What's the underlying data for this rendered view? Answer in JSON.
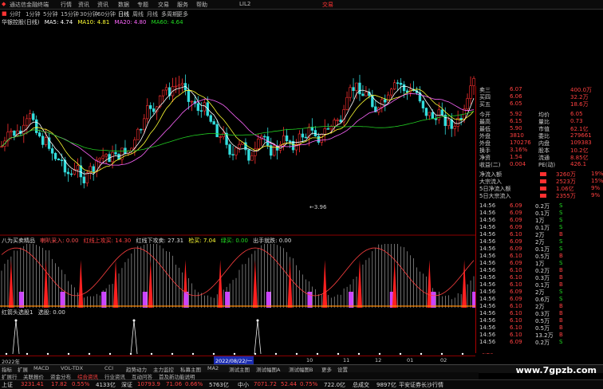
{
  "app": {
    "title": "通达信金融终端",
    "code": "LIL2",
    "trade_label": "交易"
  },
  "menu": [
    "行情",
    "资讯",
    "商城",
    "系统",
    "功能",
    "行情",
    "资讯",
    "数据",
    "专题",
    "交易",
    "服务",
    "帮助"
  ],
  "periods": [
    "分时",
    "1分钟",
    "5分钟",
    "15分钟",
    "30分钟",
    "60分钟",
    "日线",
    "周线",
    "月线",
    "多周期",
    "更多"
  ],
  "stock": {
    "name": "华银控股(日线)"
  },
  "ma": {
    "ma5": "MA5: 4.74",
    "ma10": "MA10: 4.81",
    "ma20": "MA20: 4.80",
    "ma60": "MA60: 4.64"
  },
  "price_axis": [
    "5.00",
    "4.90",
    "4.80",
    "4.70",
    "4.60",
    "4.50",
    "4.40",
    "4.30",
    "4.20",
    "4.10",
    "4.01"
  ],
  "low_label": "3.96",
  "indicator1": {
    "name": "八为买卖精品",
    "items": [
      "喇叭采入: 0.00",
      "红线上攻买: 14.30",
      "红线下攻卖: 27.31",
      "检买: 7.04",
      "绿买: 0.00",
      "出手就跌: 0.00"
    ],
    "axis": [
      "75.00",
      "60.00",
      "45.00",
      "30.00",
      "15.00"
    ]
  },
  "indicator2": {
    "name": "红箭头选股1",
    "item": "选股: 0.00",
    "axis": [
      "1.00",
      "0.80",
      "0.60",
      "0.40",
      "0.20"
    ]
  },
  "date_axis": {
    "start": "2022年",
    "cursor": "2022/08/22/一",
    "ticks": [
      "10",
      "11",
      "12",
      "01",
      "02"
    ]
  },
  "quote_rows": [
    {
      "label": "卖三",
      "price": "6.07",
      "vol": "400.0万"
    },
    {
      "label": "买四",
      "price": "6.06",
      "vol": "32.2万"
    },
    {
      "label": "买五",
      "price": "6.05",
      "vol": "18.6万"
    }
  ],
  "stats": [
    {
      "l1": "今开",
      "v1": "5.92",
      "l2": "均价",
      "v2": "6.05"
    },
    {
      "l1": "最高",
      "v1": "6.15",
      "l2": "量比",
      "v2": "0.73"
    },
    {
      "l1": "最低",
      "v1": "5.90",
      "l2": "市值",
      "v2": "62.1亿"
    },
    {
      "l1": "外盘",
      "v1": "3810",
      "l2": "委比",
      "v2": "279661"
    },
    {
      "l1": "外盘",
      "v1": "170276",
      "l2": "内盘",
      "v2": "109383"
    },
    {
      "l1": "换手",
      "v1": "3.16%",
      "l2": "股本",
      "v2": "10.2亿"
    },
    {
      "l1": "净资",
      "v1": "1.54",
      "l2": "流通",
      "v2": "8.85亿"
    },
    {
      "l1": "收益(二)",
      "v1": "0.004",
      "l2": "PE(动)",
      "v2": "426.1"
    }
  ],
  "flows": [
    {
      "label": "净流入额",
      "value": "3260万",
      "pct": "19%"
    },
    {
      "label": "大宗流入",
      "value": "2523万",
      "pct": "15%"
    },
    {
      "label": "5日净流入额",
      "value": "1.06亿",
      "pct": "9%"
    },
    {
      "label": "5日大宗流入",
      "value": "2355万",
      "pct": "9%"
    }
  ],
  "ticks": [
    {
      "t": "14:56",
      "p": "6.09",
      "v": "0.2万",
      "s": "S"
    },
    {
      "t": "14:56",
      "p": "6.09",
      "v": "0.1万",
      "s": "S"
    },
    {
      "t": "14:56",
      "p": "6.09",
      "v": "1万",
      "s": "S"
    },
    {
      "t": "14:56",
      "p": "6.09",
      "v": "0.1万",
      "s": "S"
    },
    {
      "t": "14:56",
      "p": "6.10",
      "v": "2万",
      "s": "B"
    },
    {
      "t": "14:56",
      "p": "6.09",
      "v": "2万",
      "s": "S"
    },
    {
      "t": "14:56",
      "p": "6.09",
      "v": "0.1万",
      "s": "S"
    },
    {
      "t": "14:56",
      "p": "6.10",
      "v": "0.5万",
      "s": "B"
    },
    {
      "t": "14:56",
      "p": "6.09",
      "v": "1万",
      "s": "S"
    },
    {
      "t": "14:56",
      "p": "6.10",
      "v": "0.2万",
      "s": "B"
    },
    {
      "t": "14:56",
      "p": "6.10",
      "v": "0.3万",
      "s": "B"
    },
    {
      "t": "14:56",
      "p": "6.10",
      "v": "0.1万",
      "s": "B"
    },
    {
      "t": "14:56",
      "p": "6.09",
      "v": "2万",
      "s": "S"
    },
    {
      "t": "14:56",
      "p": "6.09",
      "v": "0.6万",
      "s": "S"
    },
    {
      "t": "14:56",
      "p": "6.10",
      "v": "2万",
      "s": "B"
    },
    {
      "t": "14:56",
      "p": "6.10",
      "v": "0.3万",
      "s": "B"
    },
    {
      "t": "14:56",
      "p": "6.10",
      "v": "0.5万",
      "s": "B"
    },
    {
      "t": "14:56",
      "p": "6.10",
      "v": "0.5万",
      "s": "B"
    },
    {
      "t": "14:56",
      "p": "6.10",
      "v": "13.2万",
      "s": "B"
    },
    {
      "t": "14:56",
      "p": "6.09",
      "v": "0.2万",
      "s": "S"
    },
    {
      "t": "14:56",
      "p": "6.09",
      "v": "1万",
      "s": "S"
    }
  ],
  "bottom_tabs": [
    "指标",
    "扩展",
    "MACD",
    "VOL-TDX",
    "CCI",
    "趋势动力",
    "主力监控",
    "私募主图",
    "MA2",
    "测试主图",
    "测试幅图A",
    "测试幅图B",
    "更多",
    "设置"
  ],
  "bottom_tabs2": [
    "扩展行",
    "关联报价",
    "资金分布",
    "综合资讯",
    "行业资讯",
    "互动问答",
    "首及新功能说明"
  ],
  "status": {
    "idx1_name": "上证",
    "idx1_val": "3231.41",
    "idx1_chg": "17.82",
    "idx1_pct": "0.55%",
    "idx1_amt": "4133亿",
    "idx2_name": "深证",
    "idx2_val": "10793.9",
    "idx2_chg": "71.06",
    "idx2_pct": "0.66%",
    "idx2_amt": "5763亿",
    "idx3_name": "中小",
    "idx3_val": "7071.72",
    "idx3_chg": "52.44",
    "idx3_pct": "0.75%",
    "idx3_amt": "722.0亿",
    "idx4_name": "总成交",
    "idx4_amt": "9897亿",
    "broker": "平安证券长沙行情"
  },
  "watermark": "www.7gpzb.com",
  "colors": {
    "up": "#ff3030",
    "down": "#33dddd",
    "ma5": "#ffffff",
    "ma10": "#ffff33",
    "ma20": "#ff66ff",
    "ma60": "#22cc22",
    "grid": "#8b0000"
  }
}
